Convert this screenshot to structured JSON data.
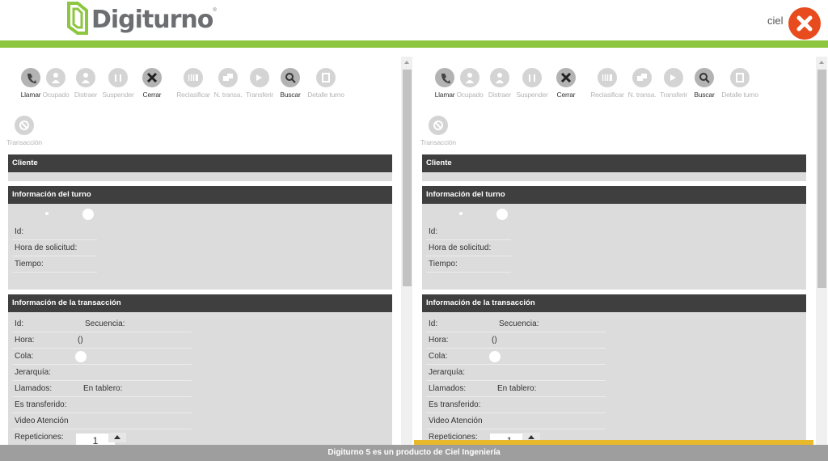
{
  "header": {
    "logo_text": "Digiturno",
    "logo_mark": "®",
    "user": "ciel",
    "colors": {
      "brand_green": "#8dc63f",
      "close_red": "#e84c1e"
    }
  },
  "toolbar": [
    {
      "label": "Llamar",
      "icon": "phone-icon",
      "active": true
    },
    {
      "label": "Ocupado",
      "icon": "person-busy-icon",
      "active": false
    },
    {
      "label": "Distraer",
      "icon": "person-icon",
      "active": false
    },
    {
      "label": "Suspender",
      "icon": "pause-icon",
      "active": false
    },
    {
      "label": "Cerrar",
      "icon": "close-icon",
      "active": true
    },
    {
      "label": "Reclasificar",
      "icon": "reclassify-icon",
      "active": false
    },
    {
      "label": "N. transa.",
      "icon": "new-transaction-icon",
      "active": false
    },
    {
      "label": "Transferir",
      "icon": "transfer-icon",
      "active": false
    },
    {
      "label": "Buscar",
      "icon": "search-icon",
      "active": true
    },
    {
      "label": "Detalle turno",
      "icon": "detail-icon",
      "active": false
    },
    {
      "label": "Transacción",
      "icon": "transaction-icon",
      "active": false
    }
  ],
  "sections": {
    "cliente": "Cliente",
    "turno": "Información del turno",
    "transaccion": "Información de la transacción"
  },
  "turno_fields": {
    "id": "Id:",
    "hora_solicitud": "Hora de solicitud:",
    "tiempo": "Tiempo:"
  },
  "transaccion_fields": {
    "id": "Id:",
    "secuencia": "Secuencia:",
    "hora": "Hora:",
    "hora_value": "()",
    "cola": "Cola:",
    "jerarquia": "Jerarquía:",
    "llamados": "Llamados:",
    "en_tablero": "En tablero:",
    "es_transferido": "Es transferido:",
    "video_atencion": "Video Atención",
    "repeticiones": "Repeticiones:",
    "repeticiones_value": "1"
  },
  "footer": "Digiturno 5 es un producto de Ciel Ingeniería"
}
